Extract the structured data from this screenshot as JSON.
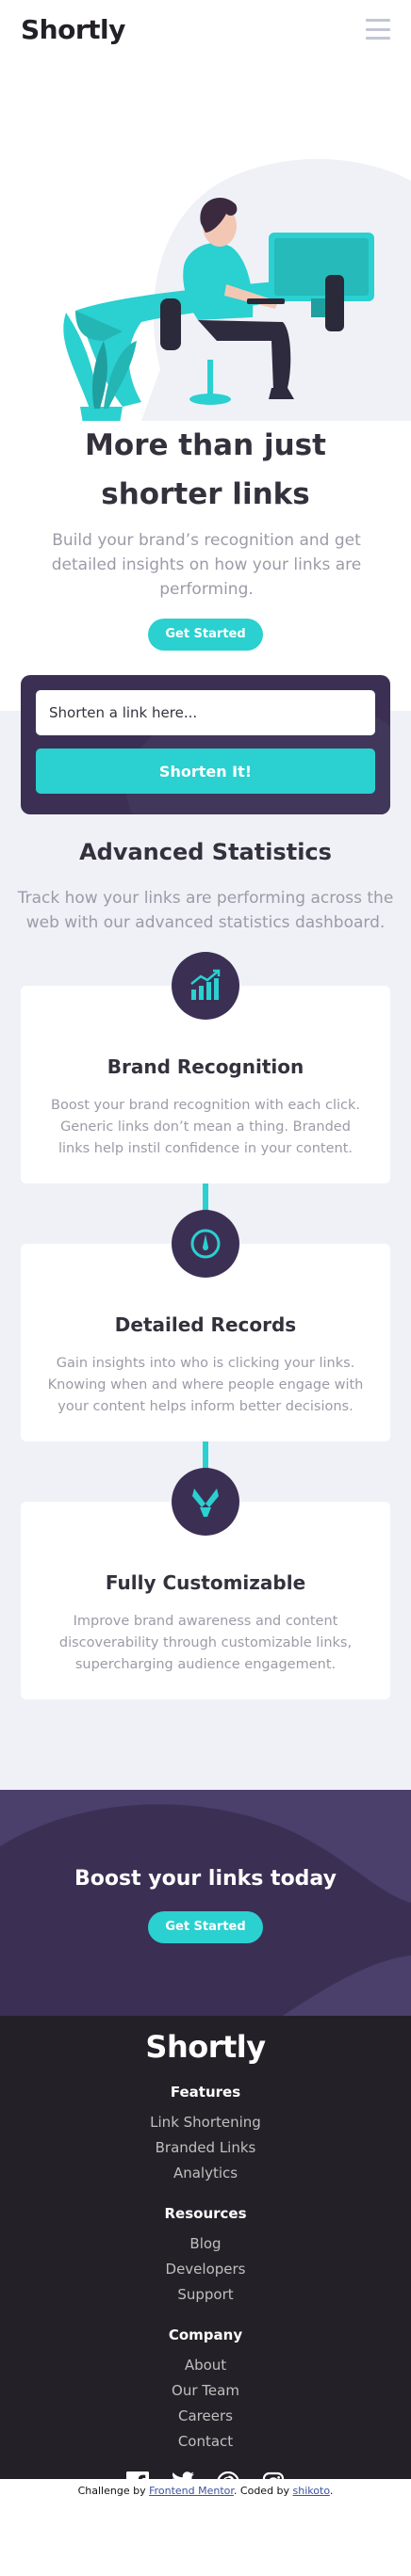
{
  "header": {
    "logo": "Shortly",
    "menu_icon": "hamburger-icon"
  },
  "hero": {
    "title": "More than just shorter links",
    "subtitle": "Build your brand’s recognition and get detailed insights on how your links are performing.",
    "cta": "Get Started",
    "illustration": "person-working-illustration"
  },
  "shorten": {
    "placeholder": "Shorten a link here...",
    "button": "Shorten It!"
  },
  "stats": {
    "title": "Advanced Statistics",
    "subtitle": "Track how your links are performing across the web with our advanced statistics dashboard.",
    "cards": [
      {
        "icon": "brand-recognition-icon",
        "title": "Brand Recognition",
        "text": "Boost your brand recognition with each click. Generic links don’t mean a thing. Branded links help instil confidence in your content."
      },
      {
        "icon": "detailed-records-icon",
        "title": "Detailed Records",
        "text": "Gain insights into who is clicking your links. Knowing when and where people engage with your content helps inform better decisions."
      },
      {
        "icon": "fully-customizable-icon",
        "title": "Fully Customizable",
        "text": "Improve brand awareness and content discoverability through customizable links, supercharging audience engagement."
      }
    ]
  },
  "boost": {
    "title": "Boost your links today",
    "cta": "Get Started"
  },
  "footer": {
    "logo": "Shortly",
    "columns": [
      {
        "title": "Features",
        "links": [
          "Link Shortening",
          "Branded Links",
          "Analytics"
        ]
      },
      {
        "title": "Resources",
        "links": [
          "Blog",
          "Developers",
          "Support"
        ]
      },
      {
        "title": "Company",
        "links": [
          "About",
          "Our Team",
          "Careers",
          "Contact"
        ]
      }
    ],
    "socials": [
      "facebook-icon",
      "twitter-icon",
      "pinterest-icon",
      "instagram-icon"
    ]
  },
  "attribution": {
    "prefix": "Challenge by ",
    "mentor": "Frontend Mentor",
    "middle": ". Coded by ",
    "author": "shikoto",
    "suffix": "."
  },
  "colors": {
    "cyan": "#2bd0d0",
    "dark_violet": "#3b3054",
    "grayish_violet": "#9e9aa7",
    "very_dark_blue": "#35323e",
    "footer_bg": "#232127",
    "stats_bg": "#eff1f7"
  }
}
